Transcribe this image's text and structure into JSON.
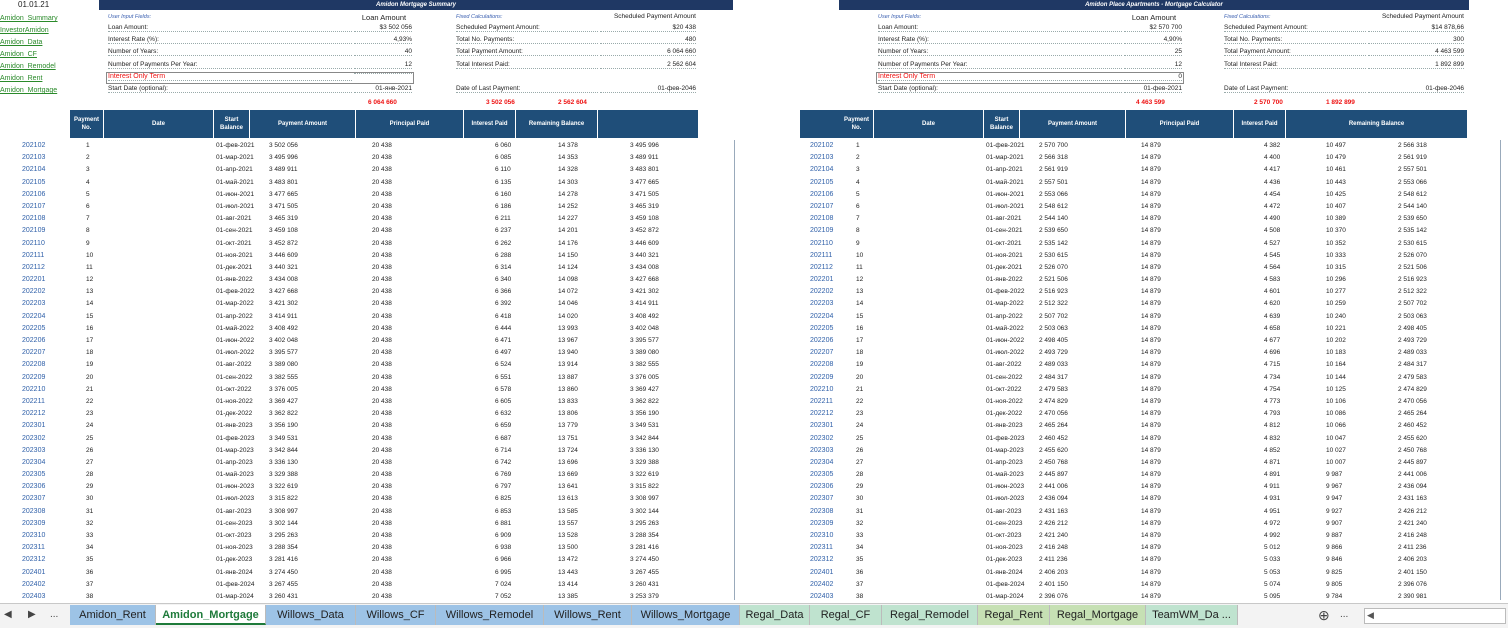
{
  "cell_ref": "01.01.21",
  "nav_links": [
    "Amidon_Summary",
    "InvestorAmidon",
    "Amidon_Data",
    "Amidon_CF",
    "Amidon_Remodel",
    "Amidon_Rent",
    "Amidon_Mortgage"
  ],
  "left": {
    "title": "Amidon Mortgage Summary",
    "user_input_label": "User Input Fields:",
    "loan_amount_header": "Loan Amount",
    "fixed_calc_label": "Fixed Calculations:",
    "sched_header": "Scheduled Payment Amount",
    "inputs": [
      {
        "label": "Loan Amount:",
        "value": "$3 502 056"
      },
      {
        "label": "Interest Rate (%):",
        "value": "4,93%"
      },
      {
        "label": "Number of Years:",
        "value": "40"
      },
      {
        "label": "Number of Payments Per Year:",
        "value": "12"
      },
      {
        "label": "Interest Only Term",
        "value": ""
      },
      {
        "label": "Start Date (optional):",
        "value": "01-янв-2021"
      }
    ],
    "fixed": [
      {
        "label": "Scheduled Payment Amount:",
        "value": "$20 438"
      },
      {
        "label": "Total No. Payments:",
        "value": "480"
      },
      {
        "label": "Total Payment Amount:",
        "value": "6 064 660"
      },
      {
        "label": "Total Interest Paid:",
        "value": "2 562 604"
      },
      {
        "label": "Date of Last Payment:",
        "value": "01-фев-2046"
      }
    ],
    "totals": [
      "6 064 660",
      "3 502 056",
      "2 562 604"
    ],
    "headers": [
      "Payment No.",
      "Date",
      "Start Balance",
      "Payment Amount",
      "Principal Paid",
      "Interest Paid",
      "Remaining Balance"
    ],
    "rows": [
      [
        "202102",
        "1",
        "01-фев-2021",
        "3 502 056",
        "20 438",
        "6 060",
        "14 378",
        "3 495 996"
      ],
      [
        "202103",
        "2",
        "01-мар-2021",
        "3 495 996",
        "20 438",
        "6 085",
        "14 353",
        "3 489 911"
      ],
      [
        "202104",
        "3",
        "01-апр-2021",
        "3 489 911",
        "20 438",
        "6 110",
        "14 328",
        "3 483 801"
      ],
      [
        "202105",
        "4",
        "01-май-2021",
        "3 483 801",
        "20 438",
        "6 135",
        "14 303",
        "3 477 665"
      ],
      [
        "202106",
        "5",
        "01-июн-2021",
        "3 477 665",
        "20 438",
        "6 160",
        "14 278",
        "3 471 505"
      ],
      [
        "202107",
        "6",
        "01-июл-2021",
        "3 471 505",
        "20 438",
        "6 186",
        "14 252",
        "3 465 319"
      ],
      [
        "202108",
        "7",
        "01-авг-2021",
        "3 465 319",
        "20 438",
        "6 211",
        "14 227",
        "3 459 108"
      ],
      [
        "202109",
        "8",
        "01-сен-2021",
        "3 459 108",
        "20 438",
        "6 237",
        "14 201",
        "3 452 872"
      ],
      [
        "202110",
        "9",
        "01-окт-2021",
        "3 452 872",
        "20 438",
        "6 262",
        "14 176",
        "3 446 609"
      ],
      [
        "202111",
        "10",
        "01-ноя-2021",
        "3 446 609",
        "20 438",
        "6 288",
        "14 150",
        "3 440 321"
      ],
      [
        "202112",
        "11",
        "01-дек-2021",
        "3 440 321",
        "20 438",
        "6 314",
        "14 124",
        "3 434 008"
      ],
      [
        "202201",
        "12",
        "01-янв-2022",
        "3 434 008",
        "20 438",
        "6 340",
        "14 098",
        "3 427 668"
      ],
      [
        "202202",
        "13",
        "01-фев-2022",
        "3 427 668",
        "20 438",
        "6 366",
        "14 072",
        "3 421 302"
      ],
      [
        "202203",
        "14",
        "01-мар-2022",
        "3 421 302",
        "20 438",
        "6 392",
        "14 046",
        "3 414 911"
      ],
      [
        "202204",
        "15",
        "01-апр-2022",
        "3 414 911",
        "20 438",
        "6 418",
        "14 020",
        "3 408 492"
      ],
      [
        "202205",
        "16",
        "01-май-2022",
        "3 408 492",
        "20 438",
        "6 444",
        "13 993",
        "3 402 048"
      ],
      [
        "202206",
        "17",
        "01-июн-2022",
        "3 402 048",
        "20 438",
        "6 471",
        "13 967",
        "3 395 577"
      ],
      [
        "202207",
        "18",
        "01-июл-2022",
        "3 395 577",
        "20 438",
        "6 497",
        "13 940",
        "3 389 080"
      ],
      [
        "202208",
        "19",
        "01-авг-2022",
        "3 389 080",
        "20 438",
        "6 524",
        "13 914",
        "3 382 555"
      ],
      [
        "202209",
        "20",
        "01-сен-2022",
        "3 382 555",
        "20 438",
        "6 551",
        "13 887",
        "3 376 005"
      ],
      [
        "202210",
        "21",
        "01-окт-2022",
        "3 376 005",
        "20 438",
        "6 578",
        "13 860",
        "3 369 427"
      ],
      [
        "202211",
        "22",
        "01-ноя-2022",
        "3 369 427",
        "20 438",
        "6 605",
        "13 833",
        "3 362 822"
      ],
      [
        "202212",
        "23",
        "01-дек-2022",
        "3 362 822",
        "20 438",
        "6 632",
        "13 806",
        "3 356 190"
      ],
      [
        "202301",
        "24",
        "01-янв-2023",
        "3 356 190",
        "20 438",
        "6 659",
        "13 779",
        "3 349 531"
      ],
      [
        "202302",
        "25",
        "01-фев-2023",
        "3 349 531",
        "20 438",
        "6 687",
        "13 751",
        "3 342 844"
      ],
      [
        "202303",
        "26",
        "01-мар-2023",
        "3 342 844",
        "20 438",
        "6 714",
        "13 724",
        "3 336 130"
      ],
      [
        "202304",
        "27",
        "01-апр-2023",
        "3 336 130",
        "20 438",
        "6 742",
        "13 696",
        "3 329 388"
      ],
      [
        "202305",
        "28",
        "01-май-2023",
        "3 329 388",
        "20 438",
        "6 769",
        "13 669",
        "3 322 619"
      ],
      [
        "202306",
        "29",
        "01-июн-2023",
        "3 322 619",
        "20 438",
        "6 797",
        "13 641",
        "3 315 822"
      ],
      [
        "202307",
        "30",
        "01-июл-2023",
        "3 315 822",
        "20 438",
        "6 825",
        "13 613",
        "3 308 997"
      ],
      [
        "202308",
        "31",
        "01-авг-2023",
        "3 308 997",
        "20 438",
        "6 853",
        "13 585",
        "3 302 144"
      ],
      [
        "202309",
        "32",
        "01-сен-2023",
        "3 302 144",
        "20 438",
        "6 881",
        "13 557",
        "3 295 263"
      ],
      [
        "202310",
        "33",
        "01-окт-2023",
        "3 295 263",
        "20 438",
        "6 909",
        "13 528",
        "3 288 354"
      ],
      [
        "202311",
        "34",
        "01-ноя-2023",
        "3 288 354",
        "20 438",
        "6 938",
        "13 500",
        "3 281 416"
      ],
      [
        "202312",
        "35",
        "01-дек-2023",
        "3 281 416",
        "20 438",
        "6 966",
        "13 472",
        "3 274 450"
      ],
      [
        "202401",
        "36",
        "01-янв-2024",
        "3 274 450",
        "20 438",
        "6 995",
        "13 443",
        "3 267 455"
      ],
      [
        "202402",
        "37",
        "01-фев-2024",
        "3 267 455",
        "20 438",
        "7 024",
        "13 414",
        "3 260 431"
      ],
      [
        "202403",
        "38",
        "01-мар-2024",
        "3 260 431",
        "20 438",
        "7 052",
        "13 385",
        "3 253 379"
      ]
    ]
  },
  "right": {
    "title": "Amidon Place Apartments - Mortgage Calculator",
    "user_input_label": "User Input Fields:",
    "loan_amount_header": "Loan Amount",
    "fixed_calc_label": "Fixed Calculations:",
    "sched_header": "Scheduled Payment Amount",
    "inputs": [
      {
        "label": "Loan Amount:",
        "value": "$2 570 700"
      },
      {
        "label": "Interest Rate (%):",
        "value": "4,90%"
      },
      {
        "label": "Number of Years:",
        "value": "25"
      },
      {
        "label": "Number of Payments Per Year:",
        "value": "12"
      },
      {
        "label": "Interest Only Term",
        "value": "0"
      },
      {
        "label": "Start Date (optional):",
        "value": "01-фев-2021"
      }
    ],
    "fixed": [
      {
        "label": "Scheduled Payment Amount:",
        "value": "$14 878,66"
      },
      {
        "label": "Total No. Payments:",
        "value": "300"
      },
      {
        "label": "Total Payment Amount:",
        "value": "4 463 599"
      },
      {
        "label": "Total Interest Paid:",
        "value": "1 892 899"
      },
      {
        "label": "Date of Last Payment:",
        "value": "01-фев-2046"
      }
    ],
    "totals": [
      "4 463 599",
      "2 570 700",
      "1 892 899"
    ],
    "headers": [
      "Payment No.",
      "Date",
      "Start Balance",
      "Payment Amount",
      "Principal Paid",
      "Interest Paid",
      "Remaining Balance"
    ],
    "rows": [
      [
        "202102",
        "1",
        "01-фев-2021",
        "2 570 700",
        "14 879",
        "4 382",
        "10 497",
        "2 566 318"
      ],
      [
        "202103",
        "2",
        "01-мар-2021",
        "2 566 318",
        "14 879",
        "4 400",
        "10 479",
        "2 561 919"
      ],
      [
        "202104",
        "3",
        "01-апр-2021",
        "2 561 919",
        "14 879",
        "4 417",
        "10 461",
        "2 557 501"
      ],
      [
        "202105",
        "4",
        "01-май-2021",
        "2 557 501",
        "14 879",
        "4 436",
        "10 443",
        "2 553 066"
      ],
      [
        "202106",
        "5",
        "01-июн-2021",
        "2 553 066",
        "14 879",
        "4 454",
        "10 425",
        "2 548 612"
      ],
      [
        "202107",
        "6",
        "01-июл-2021",
        "2 548 612",
        "14 879",
        "4 472",
        "10 407",
        "2 544 140"
      ],
      [
        "202108",
        "7",
        "01-авг-2021",
        "2 544 140",
        "14 879",
        "4 490",
        "10 389",
        "2 539 650"
      ],
      [
        "202109",
        "8",
        "01-сен-2021",
        "2 539 650",
        "14 879",
        "4 508",
        "10 370",
        "2 535 142"
      ],
      [
        "202110",
        "9",
        "01-окт-2021",
        "2 535 142",
        "14 879",
        "4 527",
        "10 352",
        "2 530 615"
      ],
      [
        "202111",
        "10",
        "01-ноя-2021",
        "2 530 615",
        "14 879",
        "4 545",
        "10 333",
        "2 526 070"
      ],
      [
        "202112",
        "11",
        "01-дек-2021",
        "2 526 070",
        "14 879",
        "4 564",
        "10 315",
        "2 521 506"
      ],
      [
        "202201",
        "12",
        "01-янв-2022",
        "2 521 506",
        "14 879",
        "4 583",
        "10 296",
        "2 516 923"
      ],
      [
        "202202",
        "13",
        "01-фев-2022",
        "2 516 923",
        "14 879",
        "4 601",
        "10 277",
        "2 512 322"
      ],
      [
        "202203",
        "14",
        "01-мар-2022",
        "2 512 322",
        "14 879",
        "4 620",
        "10 259",
        "2 507 702"
      ],
      [
        "202204",
        "15",
        "01-апр-2022",
        "2 507 702",
        "14 879",
        "4 639",
        "10 240",
        "2 503 063"
      ],
      [
        "202205",
        "16",
        "01-май-2022",
        "2 503 063",
        "14 879",
        "4 658",
        "10 221",
        "2 498 405"
      ],
      [
        "202206",
        "17",
        "01-июн-2022",
        "2 498 405",
        "14 879",
        "4 677",
        "10 202",
        "2 493 729"
      ],
      [
        "202207",
        "18",
        "01-июл-2022",
        "2 493 729",
        "14 879",
        "4 696",
        "10 183",
        "2 489 033"
      ],
      [
        "202208",
        "19",
        "01-авг-2022",
        "2 489 033",
        "14 879",
        "4 715",
        "10 164",
        "2 484 317"
      ],
      [
        "202209",
        "20",
        "01-сен-2022",
        "2 484 317",
        "14 879",
        "4 734",
        "10 144",
        "2 479 583"
      ],
      [
        "202210",
        "21",
        "01-окт-2022",
        "2 479 583",
        "14 879",
        "4 754",
        "10 125",
        "2 474 829"
      ],
      [
        "202211",
        "22",
        "01-ноя-2022",
        "2 474 829",
        "14 879",
        "4 773",
        "10 106",
        "2 470 056"
      ],
      [
        "202212",
        "23",
        "01-дек-2022",
        "2 470 056",
        "14 879",
        "4 793",
        "10 086",
        "2 465 264"
      ],
      [
        "202301",
        "24",
        "01-янв-2023",
        "2 465 264",
        "14 879",
        "4 812",
        "10 066",
        "2 460 452"
      ],
      [
        "202302",
        "25",
        "01-фев-2023",
        "2 460 452",
        "14 879",
        "4 832",
        "10 047",
        "2 455 620"
      ],
      [
        "202303",
        "26",
        "01-мар-2023",
        "2 455 620",
        "14 879",
        "4 852",
        "10 027",
        "2 450 768"
      ],
      [
        "202304",
        "27",
        "01-апр-2023",
        "2 450 768",
        "14 879",
        "4 871",
        "10 007",
        "2 445 897"
      ],
      [
        "202305",
        "28",
        "01-май-2023",
        "2 445 897",
        "14 879",
        "4 891",
        "9 987",
        "2 441 006"
      ],
      [
        "202306",
        "29",
        "01-июн-2023",
        "2 441 006",
        "14 879",
        "4 911",
        "9 967",
        "2 436 094"
      ],
      [
        "202307",
        "30",
        "01-июл-2023",
        "2 436 094",
        "14 879",
        "4 931",
        "9 947",
        "2 431 163"
      ],
      [
        "202308",
        "31",
        "01-авг-2023",
        "2 431 163",
        "14 879",
        "4 951",
        "9 927",
        "2 426 212"
      ],
      [
        "202309",
        "32",
        "01-сен-2023",
        "2 426 212",
        "14 879",
        "4 972",
        "9 907",
        "2 421 240"
      ],
      [
        "202310",
        "33",
        "01-окт-2023",
        "2 421 240",
        "14 879",
        "4 992",
        "9 887",
        "2 416 248"
      ],
      [
        "202311",
        "34",
        "01-ноя-2023",
        "2 416 248",
        "14 879",
        "5 012",
        "9 866",
        "2 411 236"
      ],
      [
        "202312",
        "35",
        "01-дек-2023",
        "2 411 236",
        "14 879",
        "5 033",
        "9 846",
        "2 406 203"
      ],
      [
        "202401",
        "36",
        "01-янв-2024",
        "2 406 203",
        "14 879",
        "5 053",
        "9 825",
        "2 401 150"
      ],
      [
        "202402",
        "37",
        "01-фев-2024",
        "2 401 150",
        "14 879",
        "5 074",
        "9 805",
        "2 396 076"
      ],
      [
        "202403",
        "38",
        "01-мар-2024",
        "2 396 076",
        "14 879",
        "5 095",
        "9 784",
        "2 390 981"
      ]
    ]
  },
  "tabs": [
    {
      "label": "Amidon_Rent",
      "style": "blue"
    },
    {
      "label": "Amidon_Mortgage",
      "style": "active"
    },
    {
      "label": "Willows_Data",
      "style": "blue"
    },
    {
      "label": "Willows_CF",
      "style": "blue"
    },
    {
      "label": "Willows_Remodel",
      "style": "blue"
    },
    {
      "label": "Willows_Rent",
      "style": "blue"
    },
    {
      "label": "Willows_Mortgage",
      "style": "blue"
    },
    {
      "label": "Regal_Data",
      "style": "teal"
    },
    {
      "label": "Regal_CF",
      "style": "teal"
    },
    {
      "label": "Regal_Remodel",
      "style": "teal"
    },
    {
      "label": "Regal_Rent",
      "style": "green"
    },
    {
      "label": "Regal_Mortgage",
      "style": "green"
    },
    {
      "label": "TeamWM_Da ...",
      "style": "teal"
    }
  ],
  "nav": {
    "prev": "◀",
    "next": "▶",
    "more": "...",
    "add": "⊕"
  }
}
